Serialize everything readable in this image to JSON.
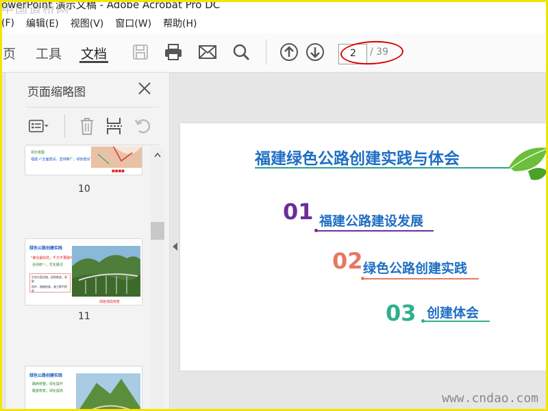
{
  "window": {
    "title": "owerPoint 演示文稿 - Adobe Acrobat Pro DC",
    "watermark_top": "中国道桥网"
  },
  "menu": [
    "(F)",
    "编辑(E)",
    "视图(V)",
    "窗口(W)",
    "帮助(H)"
  ],
  "tabs": {
    "home": "页",
    "tools": "工具",
    "document": "文档"
  },
  "navigation": {
    "current_page": "2",
    "total_pages": "/ 39"
  },
  "sidepanel": {
    "title": "页面缩略图",
    "thumbnails": [
      {
        "page_number": "10",
        "title": "",
        "lines": [
          "领示意图",
          "福建→\"全面建设，坚持推广，绿色建设\""
        ]
      },
      {
        "page_number": "11",
        "title": "绿色公路创建实践",
        "lines": [
          "\"谁也最好的，千万不要破坏\"",
          "全线统一，优化路况",
          "生态方面设施，因地制宜，采取",
          "防护，植被恢复，施工期不损失",
          "绿色地段修复"
        ]
      },
      {
        "page_number": "",
        "title": "绿色公路创建实践",
        "lines": [
          "路肩修整，绿化提升",
          "路基恢复，绿化提高"
        ]
      }
    ]
  },
  "slide": {
    "title": "福建绿色公路创建实践与体会",
    "items": [
      {
        "number": "01",
        "label": "福建公路建设发展",
        "color": "#6b2d9a"
      },
      {
        "number": "02",
        "label": "绿色公路创建实践",
        "color": "#e8775f"
      },
      {
        "number": "03",
        "label": "创建体会",
        "color": "#2fb08a"
      }
    ]
  },
  "watermark_bottom": "www.cndao.com",
  "colors": {
    "accent_blue": "#1e6ec4",
    "highlight_red": "#d90000",
    "frame_yellow": "#f2e600"
  }
}
